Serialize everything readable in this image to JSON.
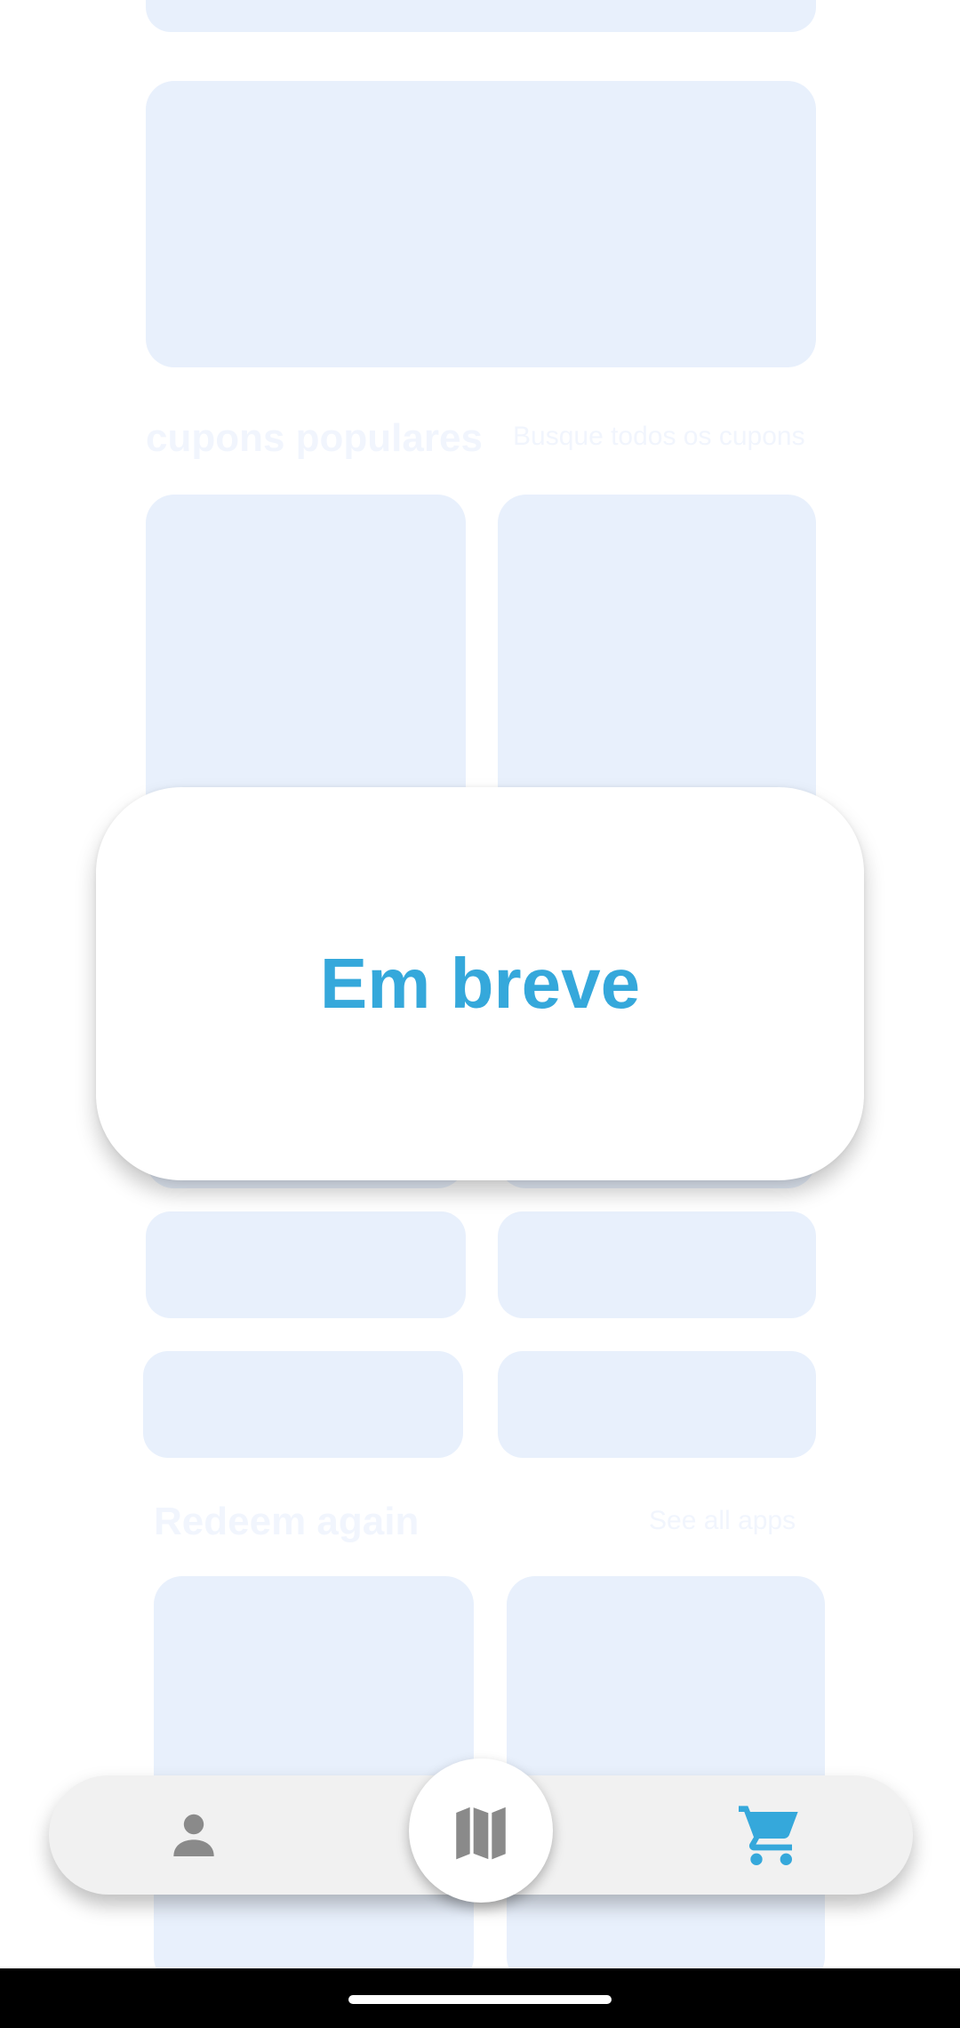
{
  "sections": {
    "popular_title": "cupons populares",
    "popular_link": "Busque todos os cupons",
    "redeem_title": "Redeem again",
    "redeem_link": "See all apps"
  },
  "modal": {
    "text": "Em breve"
  },
  "bottom_nav": {
    "items": [
      {
        "icon": "person-icon",
        "active": false
      },
      {
        "icon": "map-icon",
        "active": false
      },
      {
        "icon": "cart-icon",
        "active": true
      }
    ]
  },
  "colors": {
    "accent": "#35a8db",
    "placeholder": "#e8f0fc",
    "nav_icon": "#8a8a8a",
    "nav_background": "#f1f1f1"
  }
}
